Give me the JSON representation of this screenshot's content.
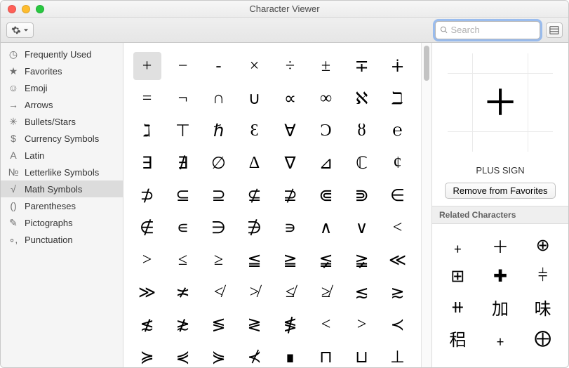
{
  "window": {
    "title": "Character Viewer"
  },
  "toolbar": {
    "search_placeholder": "Search"
  },
  "sidebar": {
    "items": [
      {
        "icon": "clock-icon",
        "glyph": "◷",
        "label": "Frequently Used"
      },
      {
        "icon": "star-icon",
        "glyph": "★",
        "label": "Favorites"
      },
      {
        "icon": "emoji-icon",
        "glyph": "☺",
        "label": "Emoji"
      },
      {
        "icon": "arrow-icon",
        "glyph": "→",
        "label": "Arrows"
      },
      {
        "icon": "asterisk-icon",
        "glyph": "✳",
        "label": "Bullets/Stars"
      },
      {
        "icon": "dollar-icon",
        "glyph": "$",
        "label": "Currency Symbols"
      },
      {
        "icon": "latin-icon",
        "glyph": "A",
        "label": "Latin"
      },
      {
        "icon": "letterlike-icon",
        "glyph": "№",
        "label": "Letterlike Symbols"
      },
      {
        "icon": "math-icon",
        "glyph": "√",
        "label": "Math Symbols"
      },
      {
        "icon": "paren-icon",
        "glyph": "()",
        "label": "Parentheses"
      },
      {
        "icon": "picto-icon",
        "glyph": "✎",
        "label": "Pictographs"
      },
      {
        "icon": "punct-icon",
        "glyph": "∘,",
        "label": "Punctuation"
      }
    ],
    "selected_index": 8
  },
  "grid": {
    "selected_index": 0,
    "chars": [
      "+",
      "−",
      "-",
      "×",
      "÷",
      "±",
      "∓",
      "∔",
      "=",
      "¬",
      "∩",
      "∪",
      "∝",
      "∞",
      "ℵ",
      "ℶ",
      "ℷ",
      "⊤",
      "ℏ",
      "Ɛ",
      "∀",
      "Ɔ",
      "ȣ",
      "℮",
      "∃",
      "∄",
      "∅",
      "∆",
      "∇",
      "⊿",
      "ℂ",
      "¢",
      "⊅",
      "⊆",
      "⊇",
      "⊈",
      "⊉",
      "⋐",
      "⋑",
      "∈",
      "∉",
      "∊",
      "∋",
      "∌",
      "∍",
      "∧",
      "∨",
      "<",
      ">",
      "≤",
      "≥",
      "≦",
      "≧",
      "≨",
      "≩",
      "≪",
      "≫",
      "≭",
      "≮",
      "≯",
      "≰",
      "≱",
      "≲",
      "≳",
      "≴",
      "≵",
      "≶",
      "≷",
      "≸",
      "<",
      ">",
      "≺",
      "≽",
      "⋞",
      "⋟",
      "⊀",
      "∎",
      "⊓",
      "⊔",
      "⊥"
    ]
  },
  "detail": {
    "char": "+",
    "name": "PLUS SIGN",
    "remove_label": "Remove from Favorites",
    "related_header": "Related Characters",
    "related": [
      "﹢",
      "＋",
      "⊕",
      "⊞",
      "✚",
      "⫩",
      "⧺",
      "加",
      "味",
      "稆",
      "﹢",
      "⨁"
    ]
  }
}
